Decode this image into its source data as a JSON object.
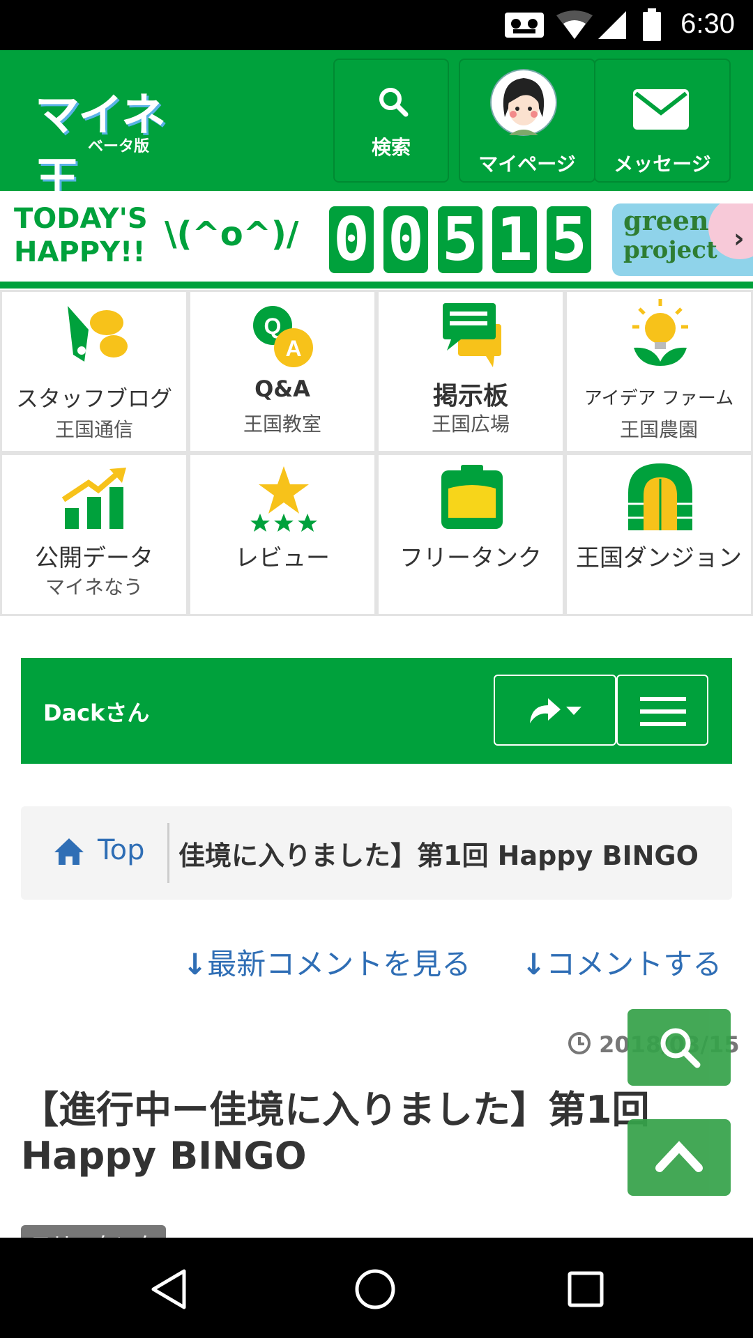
{
  "status": {
    "time": "6:30"
  },
  "header": {
    "logo_text": "マイネ王",
    "logo_sub": "ベータ版",
    "search_label": "検索",
    "mypage_label": "マイページ",
    "message_label": "メッセージ"
  },
  "banner": {
    "line1": "TODAY'S",
    "line2": "HAPPY!!",
    "face": "\\(^o^)/",
    "digits": [
      "0",
      "0",
      "5",
      "1",
      "5"
    ],
    "green_line1": "green",
    "green_line2": "project",
    "chevron": "›"
  },
  "grid": [
    {
      "title": "スタッフブログ",
      "sub": "王国通信",
      "icon": "staff-blog-icon"
    },
    {
      "title": "Q&A",
      "sub": "王国教室",
      "icon": "qa-icon"
    },
    {
      "title": "掲示板",
      "sub": "王国広場",
      "icon": "bulletin-board-icon"
    },
    {
      "title": "アイデア ファーム",
      "sub": "王国農園",
      "icon": "idea-bulb-icon"
    },
    {
      "title": "公開データ",
      "sub": "マイネなう",
      "icon": "chart-up-icon"
    },
    {
      "title": "レビュー",
      "sub": "",
      "icon": "stars-icon"
    },
    {
      "title": "フリータンク",
      "sub": "",
      "icon": "tank-icon"
    },
    {
      "title": "王国ダンジョン",
      "sub": "",
      "icon": "dungeon-door-icon"
    }
  ],
  "userbar": {
    "username": "Dackさん"
  },
  "breadcrumb": {
    "home": "Top",
    "current": "佳境に入りました】第1回 Happy BINGO"
  },
  "actions": {
    "latest_comments": "最新コメントを見る",
    "comment": "コメントする"
  },
  "post": {
    "date": "2018/03/15",
    "title_line1": "【進行中ー佳境に入りました】第1回",
    "title_line2": "Happy BINGO",
    "tag": "フリータンク"
  },
  "colors": {
    "brand_green": "#00a13c",
    "link_blue": "#2f6eb5",
    "fab_green": "#36a24a"
  }
}
